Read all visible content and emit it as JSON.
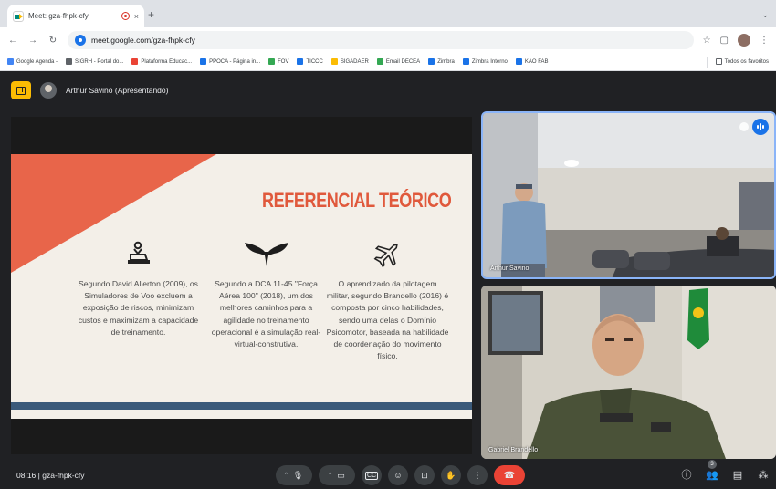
{
  "browser": {
    "tab_title": "Meet: gza-fhpk-cfy",
    "tab_close": "×",
    "newtab": "+",
    "url_host": "meet.google.com",
    "url_path": "/gza-fhpk-cfy",
    "bookmarks": [
      {
        "label": "Google Agenda -",
        "color": "#4285f4"
      },
      {
        "label": "SIGRH - Portal do...",
        "color": "#5f6368"
      },
      {
        "label": "Plataforma Educac...",
        "color": "#ea4335"
      },
      {
        "label": "PPOCA - Página in...",
        "color": "#1a73e8"
      },
      {
        "label": "FOV",
        "color": "#34a853"
      },
      {
        "label": "TICCC",
        "color": "#1a73e8"
      },
      {
        "label": "SIGADAER",
        "color": "#fbbc04"
      },
      {
        "label": "Email DECEA",
        "color": "#34a853"
      },
      {
        "label": "Zimbra",
        "color": "#1a73e8"
      },
      {
        "label": "Zimbra Interno",
        "color": "#1a73e8"
      },
      {
        "label": "KAO FAB",
        "color": "#1a73e8"
      }
    ],
    "all_bookmarks": "Todos os favoritos"
  },
  "meet": {
    "presenter": "Arthur Savino (Apresentando)",
    "slide": {
      "title": "REFERENCIAL TEÓRICO",
      "col1": "Segundo David Allerton (2009), os Simuladores de Voo excluem a exposição de riscos, minimizam custos e maximizam a capacidade de treinamento.",
      "col2": "Segundo a DCA 11-45 \"Força Aérea 100\" (2018), um dos melhores caminhos para a agilidade no treinamento operacional é a simulação real-virtual-construtiva.",
      "col3": "O aprendizado da pilotagem militar, segundo Brandello (2016) é composta por cinco habilidades, sendo uma delas o Domínio Psicomotor, baseada na habilidade de coordenação do movimento físico."
    },
    "tiles": [
      {
        "name": "Arthur Savino"
      },
      {
        "name": "Gabriel Brandello"
      }
    ],
    "time": "08:16",
    "separator": "|",
    "meeting_code": "gza-fhpk-cfy",
    "participants_count": "3"
  }
}
